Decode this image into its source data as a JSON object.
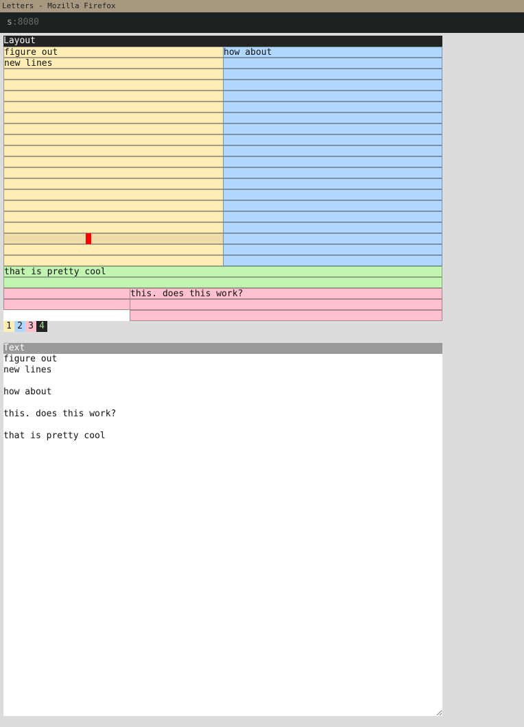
{
  "window": {
    "title": "Letters - Mozilla Firefox"
  },
  "urlbar": {
    "host": "s",
    "port": ":8080"
  },
  "layout": {
    "header": "Layout",
    "yellow_rows": [
      "figure out",
      "new lines",
      "",
      "",
      "",
      "",
      "",
      "",
      "",
      "",
      "",
      "",
      "",
      "",
      "",
      "",
      "",
      "",
      "",
      ""
    ],
    "blue_rows": [
      "how about",
      "",
      "",
      "",
      "",
      "",
      "",
      "",
      "",
      "",
      "",
      "",
      "",
      "",
      "",
      "",
      "",
      "",
      "",
      ""
    ],
    "green_rows": [
      "that is pretty cool",
      ""
    ],
    "pink_left_rows": [
      "",
      ""
    ],
    "pink_right_rows": [
      "this. does this work?",
      "",
      ""
    ],
    "active_row_index": 17,
    "colors": {
      "yellow": "#ffeeb4",
      "blue": "#b0d8ff",
      "green": "#c0f4b0",
      "pink": "#ffc0d0",
      "cursor": "#ff0000"
    }
  },
  "tabs": [
    {
      "label": "1",
      "bg": "#ffeeb4",
      "fg": "#111"
    },
    {
      "label": "2",
      "bg": "#b0d8ff",
      "fg": "#111"
    },
    {
      "label": "3",
      "bg": "#ffc0d0",
      "fg": "#111"
    },
    {
      "label": "4",
      "bg": "#222222",
      "fg": "#9fe08f"
    }
  ],
  "text": {
    "header": "Text",
    "value": "figure out\nnew lines\n\nhow about\n\nthis. does this work?\n\nthat is pretty cool"
  }
}
